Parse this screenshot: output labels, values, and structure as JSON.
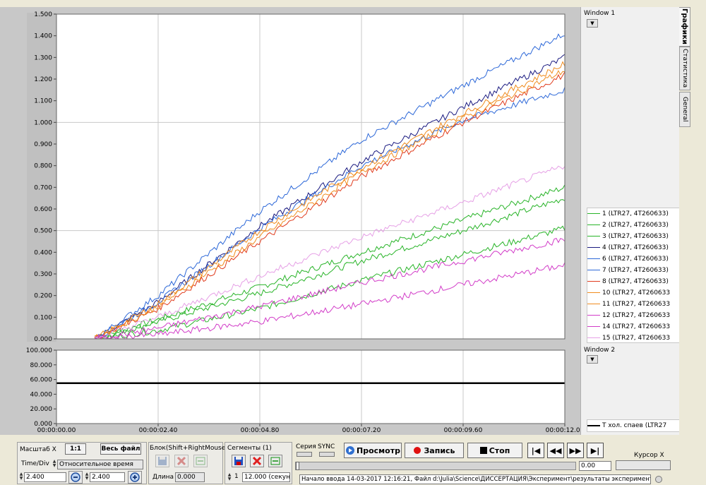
{
  "window1": {
    "label": "Window 1",
    "y_ticks": [
      "1.500",
      "1.400",
      "1.300",
      "1.200",
      "1.100",
      "1.000",
      "0.900",
      "0.800",
      "0.700",
      "0.600",
      "0.500",
      "0.400",
      "0.300",
      "0.200",
      "0.100",
      "0.000"
    ],
    "legend": [
      {
        "label": "1 (LTR27, 4T260633)",
        "color": "#28b428"
      },
      {
        "label": "2 (LTR27, 4T260633)",
        "color": "#28b428"
      },
      {
        "label": "3 (LTR27, 4T260633)",
        "color": "#28b428"
      },
      {
        "label": "4 (LTR27, 4T260633)",
        "color": "#1a1a80"
      },
      {
        "label": "6 (LTR27, 4T260633)",
        "color": "#2d68d8"
      },
      {
        "label": "7 (LTR27, 4T260633)",
        "color": "#2d68d8"
      },
      {
        "label": "8 (LTR27, 4T260633)",
        "color": "#e03c1e"
      },
      {
        "label": "10 (LTR27, 4T260633",
        "color": "#f08c1e"
      },
      {
        "label": "11 (LTR27, 4T260633",
        "color": "#f08c1e"
      },
      {
        "label": "12 (LTR27, 4T260633",
        "color": "#d23cc8"
      },
      {
        "label": "14 (LTR27, 4T260633",
        "color": "#d23cc8"
      },
      {
        "label": "15 (LTR27, 4T260633",
        "color": "#e6a0e6"
      }
    ]
  },
  "window2": {
    "label": "Window 2",
    "y_ticks": [
      "100.000",
      "80.000",
      "60.000",
      "40.000",
      "20.000",
      "0.000"
    ],
    "legend": [
      {
        "label": "T хол. спаев (LTR27",
        "color": "#000000"
      }
    ]
  },
  "x_ticks": [
    "00:00:00.00",
    "00:00:02.40",
    "00:00:04.80",
    "00:00:07.20",
    "00:00:09.60",
    "00:00:12.00"
  ],
  "tabs": [
    "Графики",
    "Статистика",
    "General"
  ],
  "chart_data": [
    {
      "type": "line",
      "title": "",
      "xlabel": "",
      "ylabel": "",
      "x_unit": "s",
      "xlim": [
        0,
        12
      ],
      "ylim": [
        0,
        1.5
      ],
      "x": [
        0.9,
        2.4,
        4.8,
        7.2,
        9.6,
        12.0
      ],
      "series": [
        {
          "name": "1 (LTR27, 4T260633)",
          "color": "#28b428",
          "values": [
            0.0,
            0.09,
            0.24,
            0.4,
            0.55,
            0.7
          ]
        },
        {
          "name": "2 (LTR27, 4T260633)",
          "color": "#28b428",
          "values": [
            0.0,
            0.08,
            0.21,
            0.36,
            0.5,
            0.65
          ]
        },
        {
          "name": "3 (LTR27, 4T260633)",
          "color": "#28b428",
          "values": [
            0.0,
            0.04,
            0.14,
            0.27,
            0.39,
            0.51
          ]
        },
        {
          "name": "4 (LTR27, 4T260633)",
          "color": "#1a1a80",
          "values": [
            0.0,
            0.17,
            0.52,
            0.82,
            1.07,
            1.3
          ]
        },
        {
          "name": "6 (LTR27, 4T260633)",
          "color": "#2d68d8",
          "values": [
            0.0,
            0.2,
            0.59,
            0.92,
            1.17,
            1.41
          ]
        },
        {
          "name": "7 (LTR27, 4T260633)",
          "color": "#2d68d8",
          "values": [
            0.0,
            0.17,
            0.51,
            0.8,
            1.01,
            1.15
          ]
        },
        {
          "name": "8 (LTR27, 4T260633)",
          "color": "#e03c1e",
          "values": [
            0.0,
            0.14,
            0.45,
            0.75,
            1.0,
            1.22
          ]
        },
        {
          "name": "10 (LTR27, 4T260633",
          "color": "#f08c1e",
          "values": [
            0.0,
            0.16,
            0.5,
            0.79,
            1.04,
            1.27
          ]
        },
        {
          "name": "11 (LTR27, 4T260633",
          "color": "#f08c1e",
          "values": [
            0.0,
            0.15,
            0.47,
            0.77,
            1.02,
            1.24
          ]
        },
        {
          "name": "12 (LTR27, 4T260633",
          "color": "#d23cc8",
          "values": [
            0.0,
            0.02,
            0.08,
            0.16,
            0.25,
            0.34
          ]
        },
        {
          "name": "14 (LTR27, 4T260633",
          "color": "#d23cc8",
          "values": [
            0.0,
            0.05,
            0.15,
            0.26,
            0.36,
            0.46
          ]
        },
        {
          "name": "15 (LTR27, 4T260633",
          "color": "#e6a0e6",
          "values": [
            0.0,
            0.1,
            0.29,
            0.47,
            0.63,
            0.8
          ]
        }
      ]
    },
    {
      "type": "line",
      "title": "",
      "xlabel": "",
      "ylabel": "",
      "x_unit": "s",
      "xlim": [
        0,
        12
      ],
      "ylim": [
        0,
        100
      ],
      "x": [
        0,
        12
      ],
      "series": [
        {
          "name": "T хол. спаев (LTR27",
          "color": "#000000",
          "values": [
            55,
            55
          ]
        }
      ]
    }
  ],
  "controls": {
    "scale_x_label": "Масштаб X",
    "one_to_one": "1:1",
    "whole_file": "Весь файл",
    "time_div_label": "Time/Div",
    "relative_time": "Относительное время",
    "zoom_value_1": "2.400",
    "zoom_value_2": "2.400",
    "block_label": "Блок(Shift+RightMouse)",
    "length_label": "Длина",
    "length_value": "0.000",
    "segments_label": "Сегменты (1)",
    "segment_index": "1",
    "segment_duration": "12.000 (секун",
    "series_label": "Серия",
    "sync_label": "SYNC",
    "preview_btn": "Просмотр",
    "record_btn": "Запись",
    "stop_btn": "Стоп",
    "nav_first": "|◀",
    "nav_prev": "◀◀",
    "nav_next": "▶▶",
    "nav_last": "▶|",
    "position_value": "0.00",
    "cursor_label": "Курсор X",
    "cursor_value": "",
    "status_text": "Начало ввода   14-03-2017 12:16:21, Файл d:\\Julia\\Science\\ДИССЕРТАЦИЯ\\Эксперимент\\результаты экспериментов\\"
  }
}
